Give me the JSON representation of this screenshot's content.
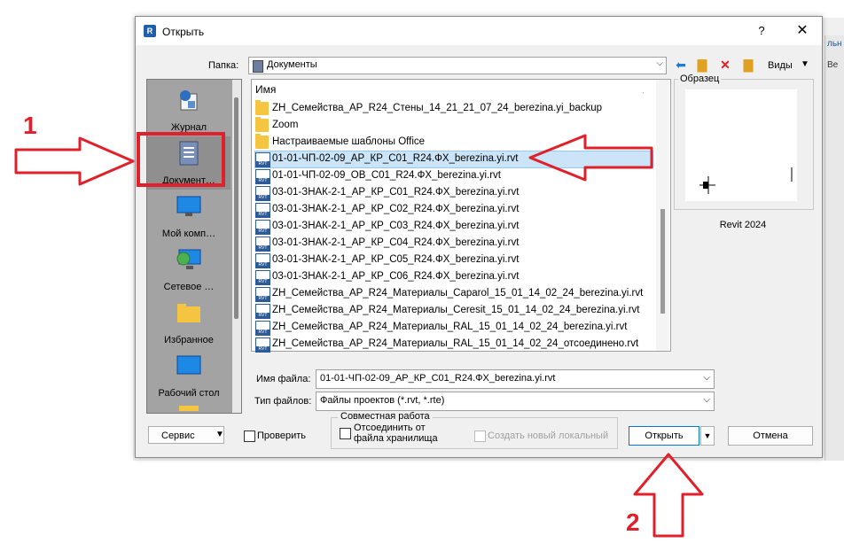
{
  "dialog": {
    "title": "Открыть",
    "help": "?",
    "close": "✕"
  },
  "folder_bar": {
    "label": "Папка:",
    "value": "Документы",
    "views_label": "Виды"
  },
  "places": [
    {
      "label": "Журнал",
      "icon": "history-icon"
    },
    {
      "label": "Документ…",
      "icon": "documents-icon"
    },
    {
      "label": "Мой комп…",
      "icon": "computer-icon"
    },
    {
      "label": "Сетевое …",
      "icon": "network-icon"
    },
    {
      "label": "Избранное",
      "icon": "folder-icon"
    },
    {
      "label": "Рабочий стол",
      "icon": "desktop-icon"
    }
  ],
  "file_list": {
    "column_header": "Имя",
    "items": [
      {
        "name": "ZH_Семейства_АР_R24_Стены_14_21_21_07_24_berezina.yi_backup",
        "type": "folder"
      },
      {
        "name": "Zoom",
        "type": "folder"
      },
      {
        "name": "Настраиваемые шаблоны Office",
        "type": "folder"
      },
      {
        "name": "01-01-ЧП-02-09_АР_КР_С01_R24.ФХ_berezina.yi.rvt",
        "type": "rvt",
        "selected": true
      },
      {
        "name": "01-01-ЧП-02-09_ОВ_С01_R24.ФХ_berezina.yi.rvt",
        "type": "rvt"
      },
      {
        "name": "03-01-ЗНАК-2-1_АР_КР_С01_R24.ФХ_berezina.yi.rvt",
        "type": "rvt"
      },
      {
        "name": "03-01-ЗНАК-2-1_АР_КР_С02_R24.ФХ_berezina.yi.rvt",
        "type": "rvt"
      },
      {
        "name": "03-01-ЗНАК-2-1_АР_КР_С03_R24.ФХ_berezina.yi.rvt",
        "type": "rvt"
      },
      {
        "name": "03-01-ЗНАК-2-1_АР_КР_С04_R24.ФХ_berezina.yi.rvt",
        "type": "rvt"
      },
      {
        "name": "03-01-ЗНАК-2-1_АР_КР_С05_R24.ФХ_berezina.yi.rvt",
        "type": "rvt"
      },
      {
        "name": "03-01-ЗНАК-2-1_АР_КР_С06_R24.ФХ_berezina.yi.rvt",
        "type": "rvt"
      },
      {
        "name": "ZH_Семейства_АР_R24_Материалы_Caparol_15_01_14_02_24_berezina.yi.rvt",
        "type": "rvt"
      },
      {
        "name": "ZH_Семейства_АР_R24_Материалы_Ceresit_15_01_14_02_24_berezina.yi.rvt",
        "type": "rvt"
      },
      {
        "name": "ZH_Семейства_АР_R24_Материалы_RAL_15_01_14_02_24_berezina.yi.rvt",
        "type": "rvt"
      },
      {
        "name": "ZH_Семейства_АР_R24_Материалы_RAL_15_01_14_02_24_отсоединено.rvt",
        "type": "rvt"
      }
    ]
  },
  "preview": {
    "label": "Образец",
    "version": "Revit 2024"
  },
  "filename": {
    "label": "Имя файла:",
    "value": "01-01-ЧП-02-09_АР_КР_С01_R24.ФХ_berezina.yi.rvt"
  },
  "filetype": {
    "label": "Тип файлов:",
    "value": "Файлы проектов  (*.rvt, *.rte)"
  },
  "worksharing": {
    "group_label": "Совместная работа",
    "detach_label": "Отсоединить от файла хранилища",
    "detach_line1": "Отсоединить от",
    "detach_line2": "файла хранилища",
    "create_local_label": "Создать новый локальный"
  },
  "buttons": {
    "service": "Сервис",
    "audit": "Проверить",
    "open": "Открыть",
    "cancel": "Отмена"
  },
  "background_app": {
    "strip_text_1": "льн",
    "strip_text_2": "Ве"
  },
  "annotations": {
    "step1": "1",
    "step2": "2",
    "color": "#e0202b"
  }
}
